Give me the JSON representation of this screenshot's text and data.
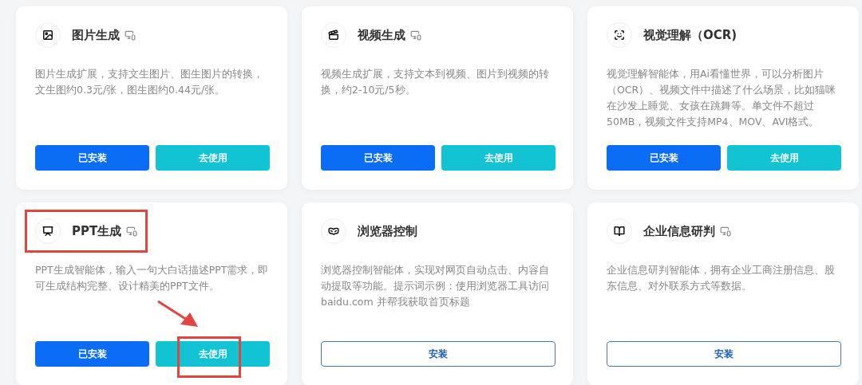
{
  "cards": [
    {
      "kind": "image",
      "title": "图片生成",
      "device_badge": true,
      "highlighted": false,
      "description": "图片生成扩展，支持文生图片、图生图片的转换，文生图约0.3元/张，图生图约0.44元/张。",
      "buttons": [
        {
          "label": "已安装",
          "kind": "installed",
          "highlighted": false
        },
        {
          "label": "去使用",
          "kind": "use",
          "highlighted": false
        }
      ]
    },
    {
      "kind": "video",
      "title": "视频生成",
      "device_badge": true,
      "highlighted": false,
      "description": "视频生成扩展，支持文本到视频、图片到视频的转换，约2-10元/5秒。",
      "buttons": [
        {
          "label": "已安装",
          "kind": "installed",
          "highlighted": false
        },
        {
          "label": "去使用",
          "kind": "use",
          "highlighted": false
        }
      ]
    },
    {
      "kind": "vision",
      "title": "视觉理解（OCR)",
      "device_badge": false,
      "highlighted": false,
      "description": "视觉理解智能体，用Ai看懂世界，可以分析图片（OCR）、视频文件中描述了什么场景，比如猫咪在沙发上睡觉、女孩在跳舞等。单文件不超过50MB，视频文件支持MP4、MOV、AVI格式。",
      "buttons": [
        {
          "label": "已安装",
          "kind": "installed",
          "highlighted": false
        },
        {
          "label": "去使用",
          "kind": "use",
          "highlighted": false
        }
      ]
    },
    {
      "kind": "slides",
      "title": "PPT生成",
      "device_badge": true,
      "highlighted": true,
      "description": "PPT生成智能体，输入一句大白话描述PPT需求，即可生成结构完整、设计精美的PPT文件。",
      "buttons": [
        {
          "label": "已安装",
          "kind": "installed",
          "highlighted": false
        },
        {
          "label": "去使用",
          "kind": "use",
          "highlighted": true
        }
      ]
    },
    {
      "kind": "browser",
      "title": "浏览器控制",
      "device_badge": false,
      "highlighted": false,
      "description": "浏览器控制智能体，实现对网页自动点击、内容自动提取等功能。提示词示例：使用浏览器工具访问 baidu.com 并帮我获取首页标题",
      "buttons": [
        {
          "label": "安装",
          "kind": "install",
          "highlighted": false
        }
      ]
    },
    {
      "kind": "company",
      "title": "企业信息研判",
      "device_badge": true,
      "highlighted": false,
      "description": "企业信息研判智能体，拥有企业工商注册信息、股东信息、对外联系方式等数据。",
      "buttons": [
        {
          "label": "安装",
          "kind": "install",
          "highlighted": false
        }
      ]
    }
  ]
}
